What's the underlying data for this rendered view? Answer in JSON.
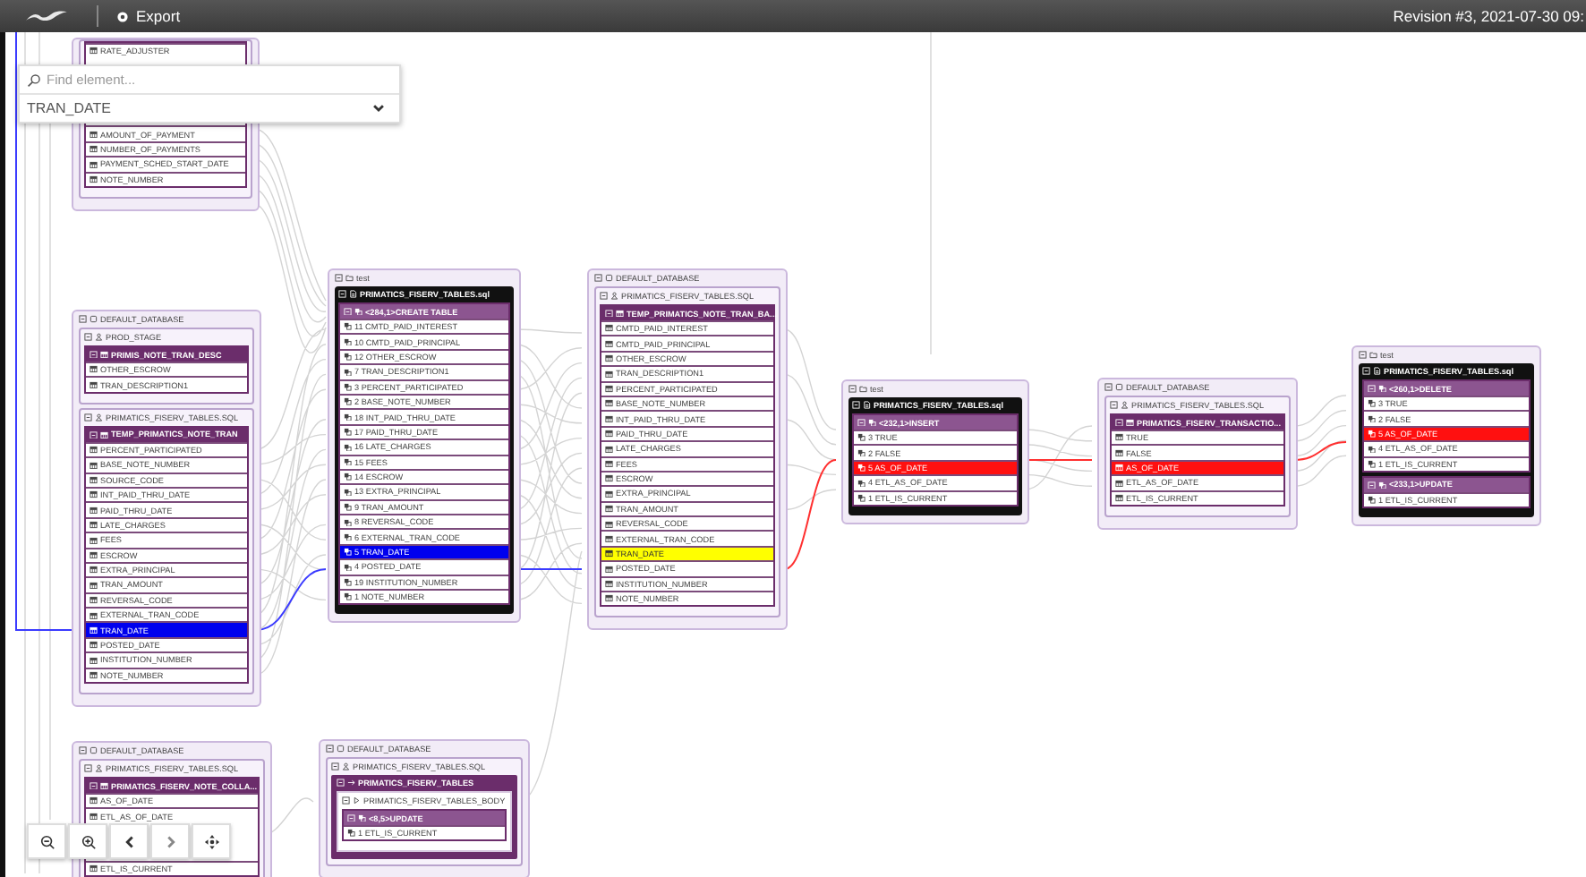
{
  "toolbar": {
    "export": "Export",
    "revision": "Revision #3, 2021-07-30 09:"
  },
  "search": {
    "placeholder": "Find element...",
    "selected_element": "TRAN_DATE"
  },
  "nodes": [
    {
      "kind": "database",
      "children": [
        {
          "kind": "schema",
          "children": [
            {
              "kind": "table",
              "segments": [
                [
                  {
                    "label": "RATE_ADJUSTER"
                  }
                ],
                [
                  {
                    "label": "AMOUNT_OF_PAYMENT"
                  },
                  {
                    "label": "NUMBER_OF_PAYMENTS"
                  },
                  {
                    "label": "PAYMENT_SCHED_START_DATE"
                  },
                  {
                    "label": "NOTE_NUMBER"
                  }
                ]
              ]
            }
          ]
        }
      ]
    },
    {
      "kind": "database",
      "label": "DEFAULT_DATABASE",
      "children": [
        {
          "kind": "schema",
          "label": "PROD_STAGE",
          "children": [
            {
              "kind": "table",
              "label": "PRIMIS_NOTE_TRAN_DESC",
              "rows": [
                {
                  "label": "OTHER_ESCROW"
                },
                {
                  "label": "TRAN_DESCRIPTION1"
                }
              ]
            }
          ]
        },
        {
          "kind": "schema",
          "label": "PRIMATICS_FISERV_TABLES.SQL",
          "children": [
            {
              "kind": "table",
              "label": "TEMP_PRIMATICS_NOTE_TRAN",
              "rows": [
                {
                  "label": "PERCENT_PARTICIPATED"
                },
                {
                  "label": "BASE_NOTE_NUMBER"
                },
                {
                  "label": "SOURCE_CODE"
                },
                {
                  "label": "INT_PAID_THRU_DATE"
                },
                {
                  "label": "PAID_THRU_DATE"
                },
                {
                  "label": "LATE_CHARGES"
                },
                {
                  "label": "FEES"
                },
                {
                  "label": "ESCROW"
                },
                {
                  "label": "EXTRA_PRINCIPAL"
                },
                {
                  "label": "TRAN_AMOUNT"
                },
                {
                  "label": "REVERSAL_CODE"
                },
                {
                  "label": "EXTERNAL_TRAN_CODE"
                },
                {
                  "label": "TRAN_DATE",
                  "color": "#0000ee"
                },
                {
                  "label": "POSTED_DATE"
                },
                {
                  "label": "INSTITUTION_NUMBER"
                },
                {
                  "label": "NOTE_NUMBER"
                }
              ]
            }
          ]
        }
      ]
    },
    {
      "kind": "folder",
      "label": "test",
      "children": [
        {
          "kind": "script",
          "label": "PRIMATICS_FISERV_TABLES.sql",
          "children": [
            {
              "kind": "statement",
              "label": "<284,1>CREATE TABLE",
              "rows": [
                {
                  "label": "11 CMTD_PAID_INTEREST"
                },
                {
                  "label": "10 CMTD_PAID_PRINCIPAL"
                },
                {
                  "label": "12 OTHER_ESCROW"
                },
                {
                  "label": "7 TRAN_DESCRIPTION1"
                },
                {
                  "label": "3 PERCENT_PARTICIPATED"
                },
                {
                  "label": "2 BASE_NOTE_NUMBER"
                },
                {
                  "label": "18 INT_PAID_THRU_DATE"
                },
                {
                  "label": "17 PAID_THRU_DATE"
                },
                {
                  "label": "16 LATE_CHARGES"
                },
                {
                  "label": "15 FEES"
                },
                {
                  "label": "14 ESCROW"
                },
                {
                  "label": "13 EXTRA_PRINCIPAL"
                },
                {
                  "label": "9 TRAN_AMOUNT"
                },
                {
                  "label": "8 REVERSAL_CODE"
                },
                {
                  "label": "6 EXTERNAL_TRAN_CODE"
                },
                {
                  "label": "5 TRAN_DATE",
                  "color": "#0000ee"
                },
                {
                  "label": "4 POSTED_DATE"
                },
                {
                  "label": "19 INSTITUTION_NUMBER"
                },
                {
                  "label": "1 NOTE_NUMBER"
                }
              ]
            }
          ]
        }
      ]
    },
    {
      "kind": "database",
      "label": "DEFAULT_DATABASE",
      "children": [
        {
          "kind": "schema",
          "label": "PRIMATICS_FISERV_TABLES.SQL",
          "children": [
            {
              "kind": "table",
              "label": "TEMP_PRIMATICS_NOTE_TRAN_BA...",
              "rows": [
                {
                  "label": "CMTD_PAID_INTEREST"
                },
                {
                  "label": "CMTD_PAID_PRINCIPAL"
                },
                {
                  "label": "OTHER_ESCROW"
                },
                {
                  "label": "TRAN_DESCRIPTION1"
                },
                {
                  "label": "PERCENT_PARTICIPATED"
                },
                {
                  "label": "BASE_NOTE_NUMBER"
                },
                {
                  "label": "INT_PAID_THRU_DATE"
                },
                {
                  "label": "PAID_THRU_DATE"
                },
                {
                  "label": "LATE_CHARGES"
                },
                {
                  "label": "FEES"
                },
                {
                  "label": "ESCROW"
                },
                {
                  "label": "EXTRA_PRINCIPAL"
                },
                {
                  "label": "TRAN_AMOUNT"
                },
                {
                  "label": "REVERSAL_CODE"
                },
                {
                  "label": "EXTERNAL_TRAN_CODE"
                },
                {
                  "label": "TRAN_DATE",
                  "color": "#ffff00"
                },
                {
                  "label": "POSTED_DATE"
                },
                {
                  "label": "INSTITUTION_NUMBER"
                },
                {
                  "label": "NOTE_NUMBER"
                }
              ]
            }
          ]
        }
      ]
    },
    {
      "kind": "folder",
      "label": "test",
      "children": [
        {
          "kind": "script",
          "label": "PRIMATICS_FISERV_TABLES.sql",
          "children": [
            {
              "kind": "statement",
              "label": "<232,1>INSERT",
              "rows": [
                {
                  "label": "3 TRUE"
                },
                {
                  "label": "2 FALSE"
                },
                {
                  "label": "5 AS_OF_DATE",
                  "color": "#ff1010"
                },
                {
                  "label": "4 ETL_AS_OF_DATE"
                },
                {
                  "label": "1 ETL_IS_CURRENT"
                }
              ]
            }
          ]
        }
      ]
    },
    {
      "kind": "database",
      "label": "DEFAULT_DATABASE",
      "children": [
        {
          "kind": "schema",
          "label": "PRIMATICS_FISERV_TABLES.SQL",
          "children": [
            {
              "kind": "table",
              "label": "PRIMATICS_FISERV_TRANSACTIO...",
              "rows": [
                {
                  "label": "TRUE"
                },
                {
                  "label": "FALSE"
                },
                {
                  "label": "AS_OF_DATE",
                  "color": "#ff1010"
                },
                {
                  "label": "ETL_AS_OF_DATE"
                },
                {
                  "label": "ETL_IS_CURRENT"
                }
              ]
            }
          ]
        }
      ]
    },
    {
      "kind": "folder",
      "label": "test",
      "children": [
        {
          "kind": "script",
          "label": "PRIMATICS_FISERV_TABLES.sql",
          "children": [
            {
              "kind": "statement",
              "label": "<260,1>DELETE",
              "rows": [
                {
                  "label": "3 TRUE"
                },
                {
                  "label": "2 FALSE"
                },
                {
                  "label": "5 AS_OF_DATE",
                  "color": "#ff1010"
                },
                {
                  "label": "4 ETL_AS_OF_DATE"
                },
                {
                  "label": "1 ETL_IS_CURRENT"
                }
              ]
            },
            {
              "kind": "statement",
              "label": "<233,1>UPDATE",
              "rows": [
                {
                  "label": "1 ETL_IS_CURRENT"
                }
              ]
            }
          ]
        }
      ]
    },
    {
      "kind": "database",
      "label": "DEFAULT_DATABASE",
      "children": [
        {
          "kind": "schema",
          "label": "PRIMATICS_FISERV_TABLES.SQL",
          "children": [
            {
              "kind": "table",
              "label": "PRIMATICS_FISERV_NOTE_COLLA...",
              "segments": [
                [
                  {
                    "label": "AS_OF_DATE"
                  },
                  {
                    "label": "ETL_AS_OF_DATE"
                  }
                ],
                [
                  {
                    "label": "ETL_IS_CURRENT"
                  }
                ]
              ]
            }
          ]
        }
      ]
    },
    {
      "kind": "database",
      "label": "DEFAULT_DATABASE",
      "children": [
        {
          "kind": "schema",
          "label": "PRIMATICS_FISERV_TABLES.SQL",
          "children": [
            {
              "kind": "procedure",
              "label": "PRIMATICS_FISERV_TABLES",
              "children": [
                {
                  "kind": "body",
                  "label": "PRIMATICS_FISERV_TABLES_BODY",
                  "children": [
                    {
                      "kind": "statement",
                      "label": "<8,5>UPDATE",
                      "rows": [
                        {
                          "label": "1 ETL_IS_CURRENT"
                        }
                      ]
                    }
                  ]
                }
              ]
            }
          ]
        }
      ]
    }
  ]
}
